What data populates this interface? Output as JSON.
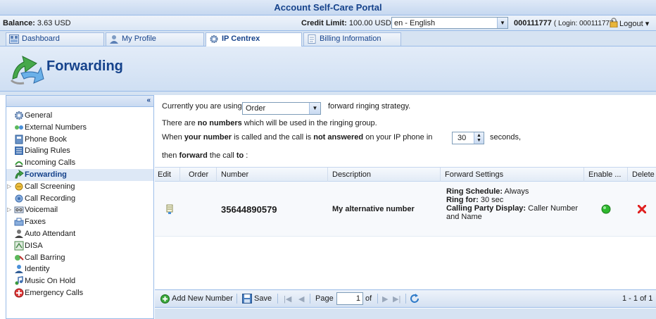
{
  "portal_title": "Account Self-Care Portal",
  "infobar": {
    "balance_label": "Balance:",
    "balance_value": "3.63 USD",
    "credit_label": "Credit Limit:",
    "credit_value": "100.00 USD",
    "language": "en - English",
    "account": "000111777",
    "login_text": "( Login: 000111777 )",
    "logout": "Logout"
  },
  "tabs": [
    {
      "label": "Dashboard",
      "icon": "dashboard-icon"
    },
    {
      "label": "My Profile",
      "icon": "profile-icon"
    },
    {
      "label": "IP Centrex",
      "icon": "gear-icon",
      "active": true
    },
    {
      "label": "Billing Information",
      "icon": "document-icon"
    }
  ],
  "page_title": "Forwarding",
  "sidebar": {
    "collapse": "«",
    "items": [
      {
        "label": "General",
        "icon": "gear-icon"
      },
      {
        "label": "External Numbers",
        "icon": "network-icon"
      },
      {
        "label": "Phone Book",
        "icon": "phonebook-icon"
      },
      {
        "label": "Dialing Rules",
        "icon": "rules-icon"
      },
      {
        "label": "Incoming Calls",
        "icon": "incoming-icon"
      },
      {
        "label": "Forwarding",
        "icon": "forwarding-icon",
        "active": true
      },
      {
        "label": "Call Screening",
        "icon": "screening-icon",
        "expandable": true
      },
      {
        "label": "Call Recording",
        "icon": "recording-icon"
      },
      {
        "label": "Voicemail",
        "icon": "voicemail-icon",
        "expandable": true
      },
      {
        "label": "Faxes",
        "icon": "fax-icon"
      },
      {
        "label": "Auto Attendant",
        "icon": "attendant-icon"
      },
      {
        "label": "DISA",
        "icon": "disa-icon"
      },
      {
        "label": "Call Barring",
        "icon": "barring-icon"
      },
      {
        "label": "Identity",
        "icon": "identity-icon"
      },
      {
        "label": "Music On Hold",
        "icon": "music-icon"
      },
      {
        "label": "Emergency Calls",
        "icon": "emergency-icon"
      }
    ]
  },
  "main": {
    "strategy_prefix": "Currently you are using",
    "strategy_value": "Order",
    "strategy_suffix": "forward ringing strategy.",
    "numbers_pre": "There are",
    "numbers_bold": "no numbers",
    "numbers_post": "which will be used in the ringing group.",
    "when_1": "When",
    "when_2": "your number",
    "when_3": "is called and the call is",
    "when_4": "not answered",
    "when_5": "on your IP phone in",
    "seconds_value": "30",
    "seconds_label": "seconds,",
    "then_1": "then",
    "then_2": "forward",
    "then_3": "the call",
    "then_4": "to",
    "then_5": ":"
  },
  "grid": {
    "headers": [
      "Edit",
      "Order",
      "Number",
      "Description",
      "Forward Settings",
      "Enable ...",
      "Delete"
    ],
    "rows": [
      {
        "number": "35644890579",
        "description": "My alternative number",
        "ring_schedule_label": "Ring Schedule:",
        "ring_schedule_value": "Always",
        "ring_for_label": "Ring for:",
        "ring_for_value": "30 sec",
        "cpd_label": "Calling Party Display:",
        "cpd_value": "Caller Number and Name",
        "enabled": true
      }
    ]
  },
  "toolbar": {
    "add": "Add New Number",
    "save": "Save",
    "page_label": "Page",
    "page_value": "1",
    "of_label": "of",
    "range": "1 - 1 of 1"
  },
  "colors": {
    "accent": "#15428b",
    "border": "#99bbe8",
    "enabled": "#2eb82e",
    "delete": "#e02020"
  }
}
